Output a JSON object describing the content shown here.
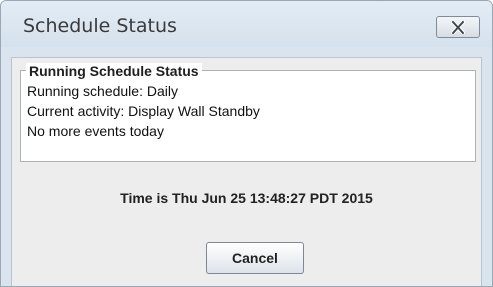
{
  "window": {
    "title": "Schedule Status",
    "close_icon": "close-icon"
  },
  "group": {
    "legend": "Running Schedule Status",
    "lines": [
      "Running schedule: Daily",
      "Current activity: Display Wall Standby",
      "No more events today"
    ]
  },
  "time_text": "Time is Thu Jun 25 13:48:27 PDT 2015",
  "buttons": {
    "cancel_label": "Cancel"
  }
}
